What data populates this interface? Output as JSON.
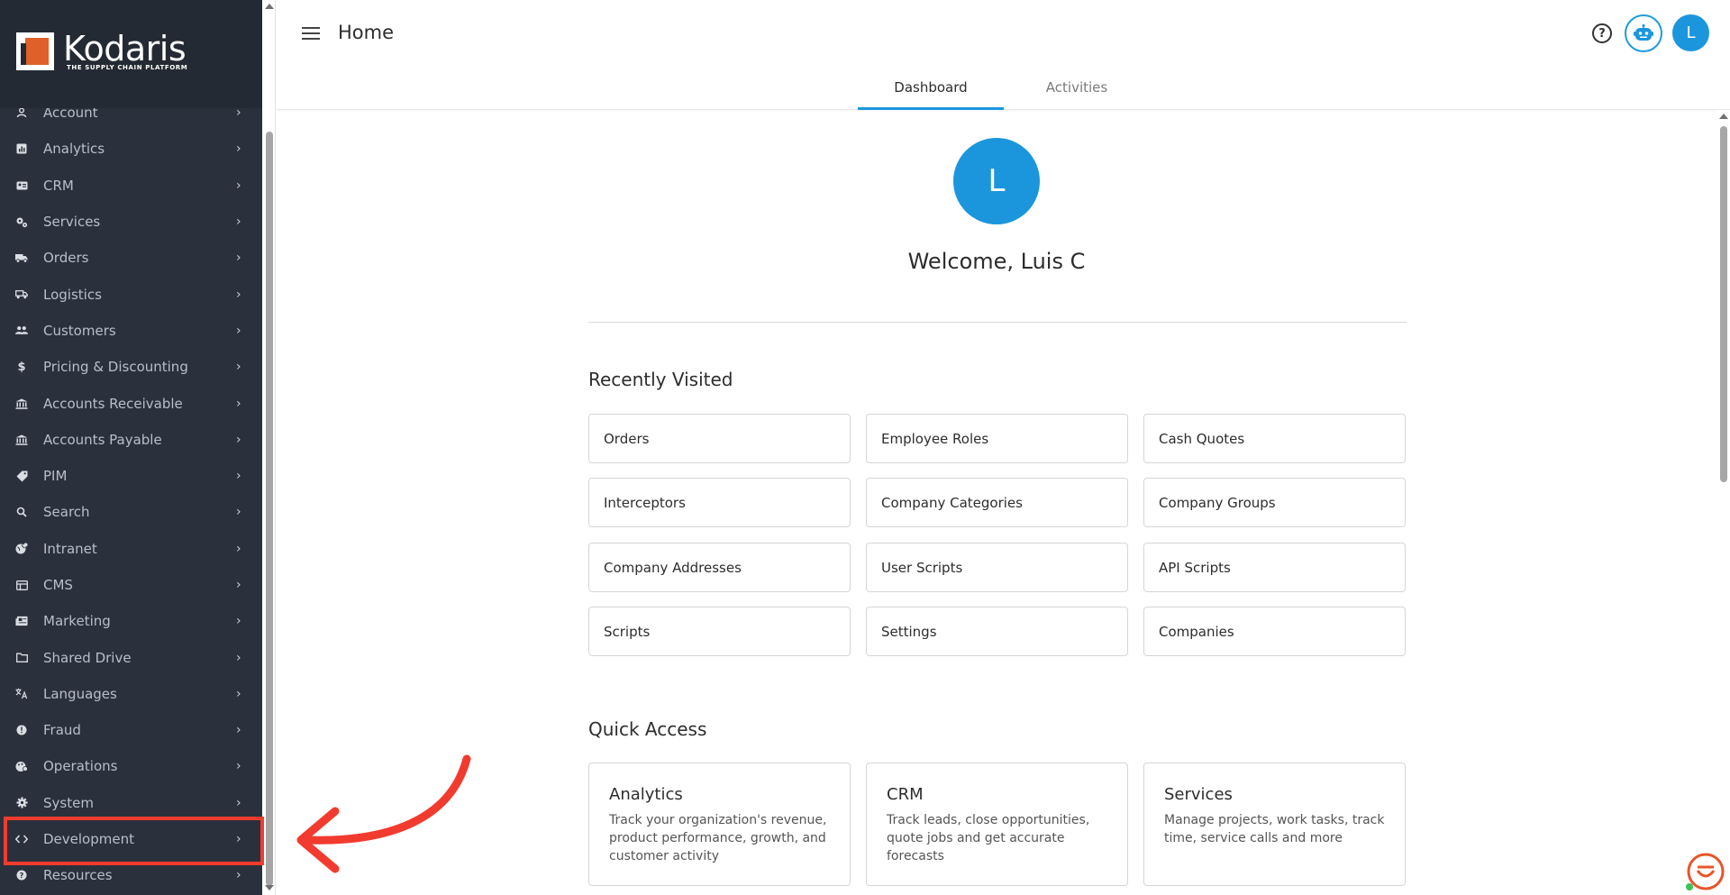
{
  "brand": {
    "name": "Kodaris",
    "tagline": "THE SUPPLY CHAIN PLATFORM"
  },
  "sidebar": {
    "items": [
      {
        "label": "Account",
        "icon": "person-icon"
      },
      {
        "label": "Analytics",
        "icon": "analytics-icon"
      },
      {
        "label": "CRM",
        "icon": "contact-card-icon"
      },
      {
        "label": "Services",
        "icon": "gears-icon"
      },
      {
        "label": "Orders",
        "icon": "truck-icon"
      },
      {
        "label": "Logistics",
        "icon": "delivery-truck-icon"
      },
      {
        "label": "Customers",
        "icon": "people-icon"
      },
      {
        "label": "Pricing & Discounting",
        "icon": "dollar-icon"
      },
      {
        "label": "Accounts Receivable",
        "icon": "bank-icon"
      },
      {
        "label": "Accounts Payable",
        "icon": "bank-icon"
      },
      {
        "label": "PIM",
        "icon": "tag-icon"
      },
      {
        "label": "Search",
        "icon": "search-icon"
      },
      {
        "label": "Intranet",
        "icon": "globe-icon"
      },
      {
        "label": "CMS",
        "icon": "cms-icon"
      },
      {
        "label": "Marketing",
        "icon": "newspaper-icon"
      },
      {
        "label": "Shared Drive",
        "icon": "folder-icon"
      },
      {
        "label": "Languages",
        "icon": "translate-icon"
      },
      {
        "label": "Fraud",
        "icon": "alert-icon"
      },
      {
        "label": "Operations",
        "icon": "palette-icon"
      },
      {
        "label": "System",
        "icon": "gear-icon"
      },
      {
        "label": "Development",
        "icon": "code-icon"
      },
      {
        "label": "Resources",
        "icon": "help-circle-icon"
      }
    ],
    "chevron": "›"
  },
  "header": {
    "title": "Home",
    "avatar_initial": "L",
    "help_glyph": "?",
    "tabs": [
      {
        "label": "Dashboard",
        "active": true
      },
      {
        "label": "Activities",
        "active": false
      }
    ]
  },
  "welcome": {
    "avatar_initial": "L",
    "text": "Welcome, Luis C"
  },
  "recently_visited": {
    "title": "Recently Visited",
    "items": [
      "Orders",
      "Employee Roles",
      "Cash Quotes",
      "Interceptors",
      "Company Categories",
      "Company Groups",
      "Company Addresses",
      "User Scripts",
      "API Scripts",
      "Scripts",
      "Settings",
      "Companies"
    ]
  },
  "quick_access": {
    "title": "Quick Access",
    "items": [
      {
        "title": "Analytics",
        "desc": "Track your organization's revenue, product performance, growth, and customer activity"
      },
      {
        "title": "CRM",
        "desc": "Track leads, close opportunities, quote jobs and get accurate forecasts"
      },
      {
        "title": "Services",
        "desc": "Manage projects, work tasks, track time, service calls and more"
      }
    ]
  },
  "colors": {
    "sidebar_bg": "#2b313c",
    "accent": "#1b96dc",
    "annotation": "#f23b2f"
  }
}
